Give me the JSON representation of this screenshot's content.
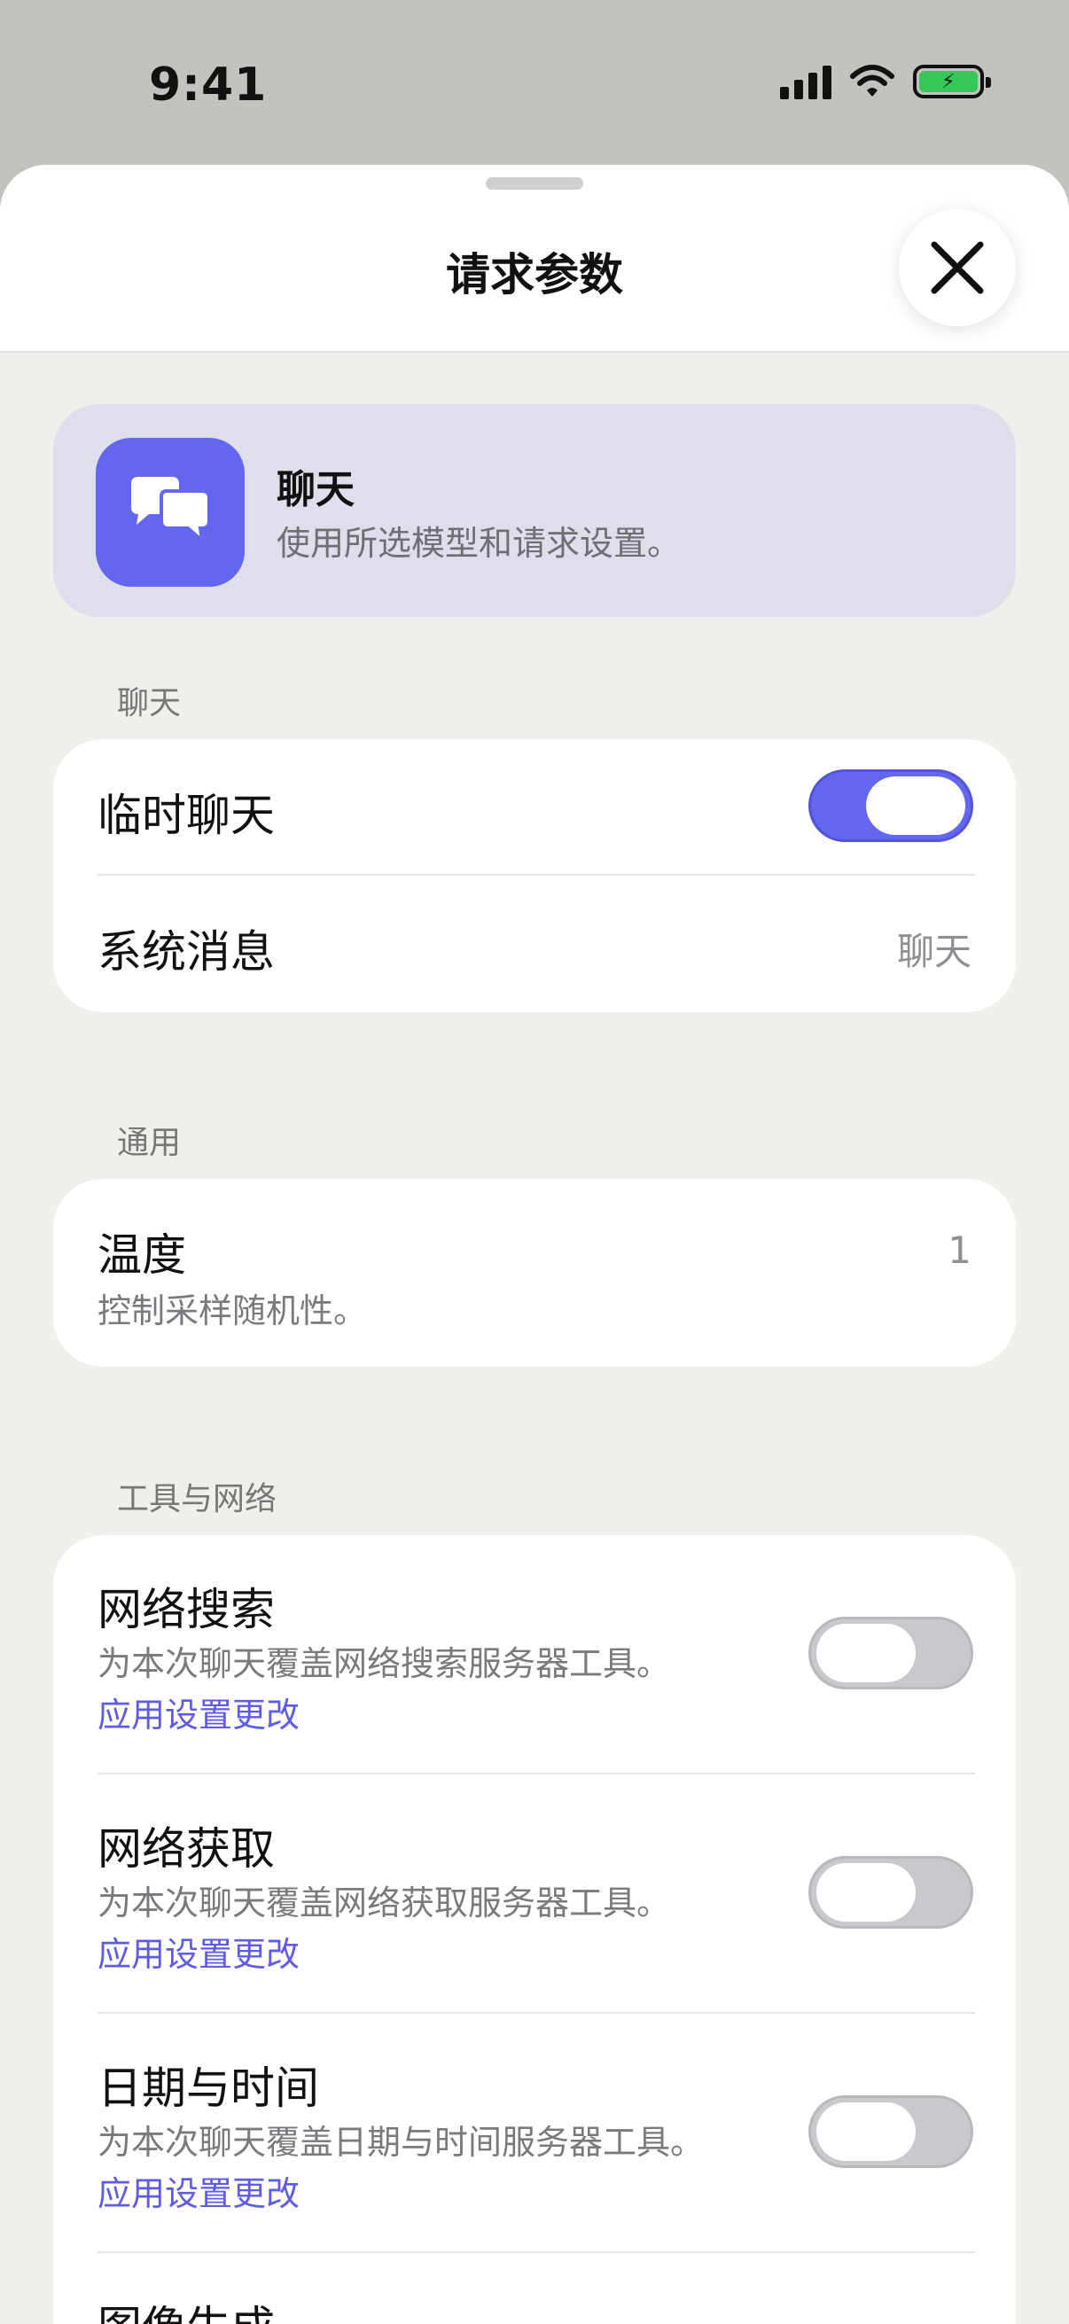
{
  "status_bar": {
    "time": "9:41"
  },
  "header": {
    "title": "请求参数"
  },
  "banner": {
    "title": "聊天",
    "subtitle": "使用所选模型和请求设置。"
  },
  "sections": {
    "chat": {
      "label": "聊天",
      "temp_chat": {
        "title": "临时聊天",
        "enabled": true
      },
      "system_message": {
        "title": "系统消息",
        "value": "聊天"
      }
    },
    "general": {
      "label": "通用",
      "temperature": {
        "title": "温度",
        "subtitle": "控制采样随机性。",
        "value": "1"
      }
    },
    "tools": {
      "label": "工具与网络",
      "items": [
        {
          "title": "网络搜索",
          "subtitle": "为本次聊天覆盖网络搜索服务器工具。",
          "link": "应用设置更改",
          "enabled": false
        },
        {
          "title": "网络获取",
          "subtitle": "为本次聊天覆盖网络获取服务器工具。",
          "link": "应用设置更改",
          "enabled": false
        },
        {
          "title": "日期与时间",
          "subtitle": "为本次聊天覆盖日期与时间服务器工具。",
          "link": "应用设置更改",
          "enabled": false
        },
        {
          "title": "图像生成"
        }
      ]
    }
  },
  "icons": {
    "close": "close-icon",
    "banner": "chat-bubbles-icon",
    "signal": "cellular-signal-icon",
    "wifi": "wifi-icon",
    "battery": "battery-charging-icon"
  },
  "colors": {
    "accent": "#6366ef",
    "link": "#5e5ce6",
    "battery": "#35c759"
  }
}
